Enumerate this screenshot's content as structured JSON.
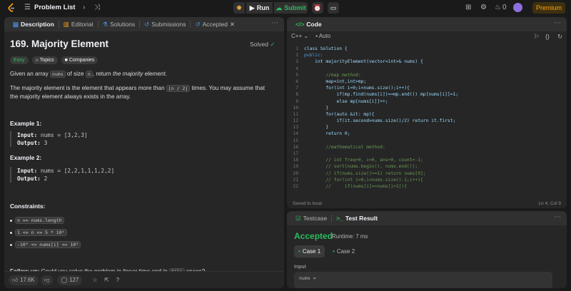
{
  "topbar": {
    "problem_list": "Problem List",
    "run": "Run",
    "submit": "Submit",
    "streak": "0",
    "premium": "Premium"
  },
  "description_panel": {
    "tabs": [
      "Description",
      "Editorial",
      "Solutions",
      "Submissions",
      "Accepted"
    ],
    "title": "169. Majority Element",
    "status": "Solved",
    "difficulty": "Easy",
    "chips": [
      "Topics",
      "Companies"
    ],
    "p1_before": "Given an array ",
    "p1_code1": "nums",
    "p1_mid": " of size ",
    "p1_code2": "n",
    "p1_after": ", return ",
    "p1_em": "the majority element",
    "p1_end": ".",
    "p2_before": "The majority element is the element that appears more than ",
    "p2_code": "⌊n / 2⌋",
    "p2_after": " times. You may assume that the majority element always exists in the array.",
    "example1_title": "Example 1:",
    "example1_input_label": "Input:",
    "example1_input": "nums = [3,2,3]",
    "example1_output_label": "Output:",
    "example1_output": "3",
    "example2_title": "Example 2:",
    "example2_input_label": "Input:",
    "example2_input": "nums = [2,2,1,1,1,2,2]",
    "example2_output_label": "Output:",
    "example2_output": "2",
    "constraints_title": "Constraints:",
    "constraints": [
      "n == nums.length",
      "1 <= n <= 5 * 10⁴",
      "-10⁹ <= nums[i] <= 10⁹"
    ],
    "followup_label": "Follow-up:",
    "followup_text": " Could you solve the problem in linear time and in ",
    "followup_code": "O(1)",
    "followup_end": " space?",
    "likes": "17.6K",
    "comments": "127"
  },
  "code_panel": {
    "title": "Code",
    "language": "C++",
    "mode": "Auto",
    "saved": "Saved to local",
    "cursor": "Ln 4, Col 9",
    "lines": [
      {
        "n": "1",
        "t": "class Solution {",
        "c": "ct"
      },
      {
        "n": "2",
        "t": "public:",
        "c": "kw"
      },
      {
        "n": "3",
        "t": "    int majorityElement(vector<int>& nums) {",
        "c": "ct"
      },
      {
        "n": "4",
        "t": "",
        "c": "ct"
      },
      {
        "n": "5",
        "t": "        //map method:",
        "c": "cm"
      },
      {
        "n": "6",
        "t": "        map<int,int>mp;",
        "c": "ct"
      },
      {
        "n": "7",
        "t": "        for(int i=0;i<nums.size();i++){",
        "c": "ct"
      },
      {
        "n": "8",
        "t": "            if(mp.find(nums[i])==mp.end()) mp[nums[i]]=1;",
        "c": "ct"
      },
      {
        "n": "9",
        "t": "            else mp[nums[i]]++;",
        "c": "ct"
      },
      {
        "n": "10",
        "t": "        }",
        "c": "ct"
      },
      {
        "n": "11",
        "t": "        for(auto &it: mp){",
        "c": "ct"
      },
      {
        "n": "12",
        "t": "            if(it.second>nums.size()/2) return it.first;",
        "c": "ct"
      },
      {
        "n": "13",
        "t": "        }",
        "c": "ct"
      },
      {
        "n": "14",
        "t": "        return 0;",
        "c": "ct"
      },
      {
        "n": "15",
        "t": "",
        "c": "ct"
      },
      {
        "n": "16",
        "t": "        //mathematical method:",
        "c": "cm"
      },
      {
        "n": "17",
        "t": "",
        "c": "ct"
      },
      {
        "n": "18",
        "t": "        // int freq=0, c=0, ans=0, count=-1;",
        "c": "cm"
      },
      {
        "n": "19",
        "t": "        // sort(nums.begin(), nums.end());",
        "c": "cm"
      },
      {
        "n": "20",
        "t": "        // if(nums.size()==1) return nums[0];",
        "c": "cm"
      },
      {
        "n": "21",
        "t": "        // for(int i=0;i<nums.size()-1;i++){",
        "c": "cm"
      },
      {
        "n": "22",
        "t": "        //     if(nums[i]==nums[i+1]){",
        "c": "cm"
      }
    ]
  },
  "result_panel": {
    "tabs": [
      "Testcase",
      "Test Result"
    ],
    "status": "Accepted",
    "runtime": "Runtime: 7 ms",
    "cases": [
      "Case 1",
      "Case 2"
    ],
    "input_label": "Input",
    "input_value": "nums ="
  }
}
